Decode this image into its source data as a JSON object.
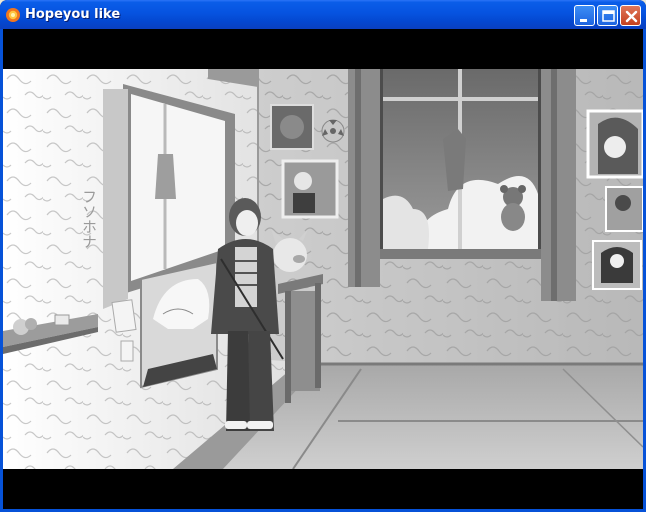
{
  "window": {
    "title": "Hopeyou like",
    "controls": {
      "minimize": "minimize",
      "maximize": "maximize",
      "close": "close"
    }
  },
  "scene": {
    "background": "grayscale-bedroom",
    "wall_characters": "フソホナ"
  },
  "colors": {
    "titlebar": "#0653e0",
    "close": "#c4401e",
    "letterbox": "#000000"
  }
}
